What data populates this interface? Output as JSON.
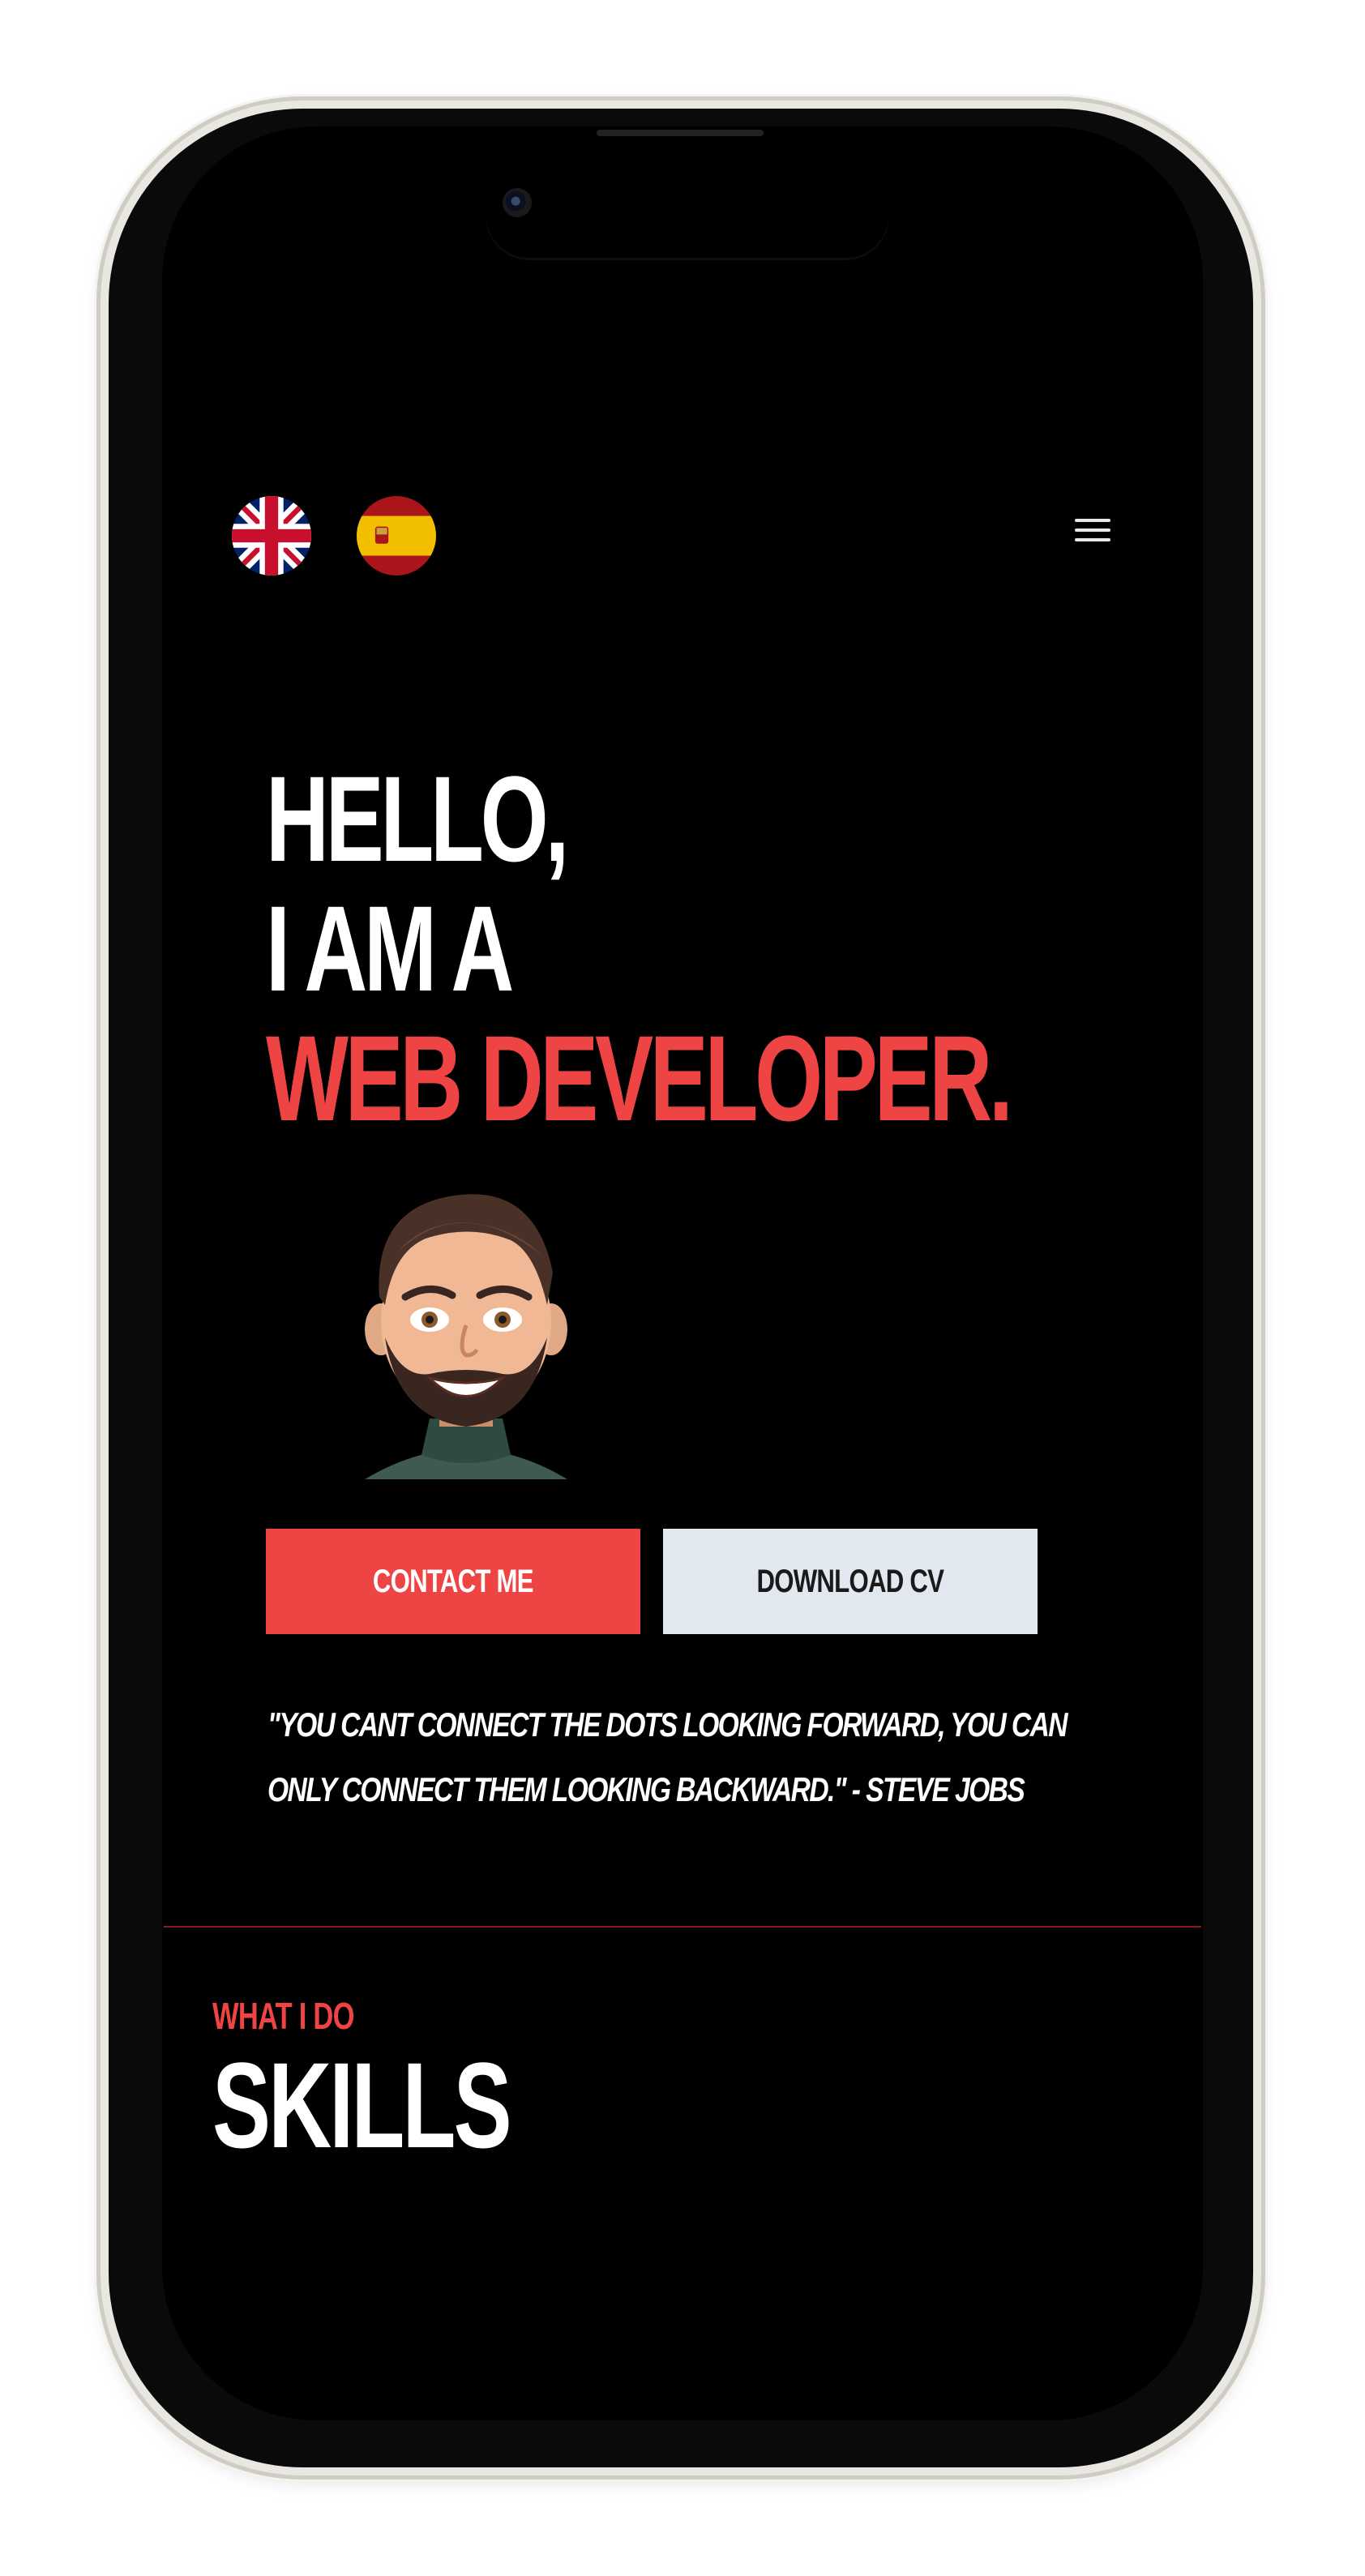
{
  "header": {
    "languages": [
      {
        "code": "en",
        "icon": "uk-flag-icon"
      },
      {
        "code": "es",
        "icon": "spain-flag-icon"
      }
    ],
    "menu_icon": "hamburger-menu-icon"
  },
  "hero": {
    "line1": "HELLO,",
    "line2": "I AM A",
    "line3": "WEB DEVELOPER.",
    "avatar_icon": "memoji-avatar",
    "contact_label": "CONTACT ME",
    "download_label": "DOWNLOAD CV",
    "quote": "\"YOU CANT CONNECT THE DOTS LOOKING FORWARD, YOU CAN ONLY CONNECT THEM LOOKING BACKWARD.\" - STEVE JOBS"
  },
  "skills": {
    "eyebrow": "WHAT I DO",
    "title": "SKILLS"
  },
  "colors": {
    "accent": "#ef4444",
    "background": "#000000",
    "secondary_button": "#e2e8f0",
    "text": "#ffffff"
  }
}
